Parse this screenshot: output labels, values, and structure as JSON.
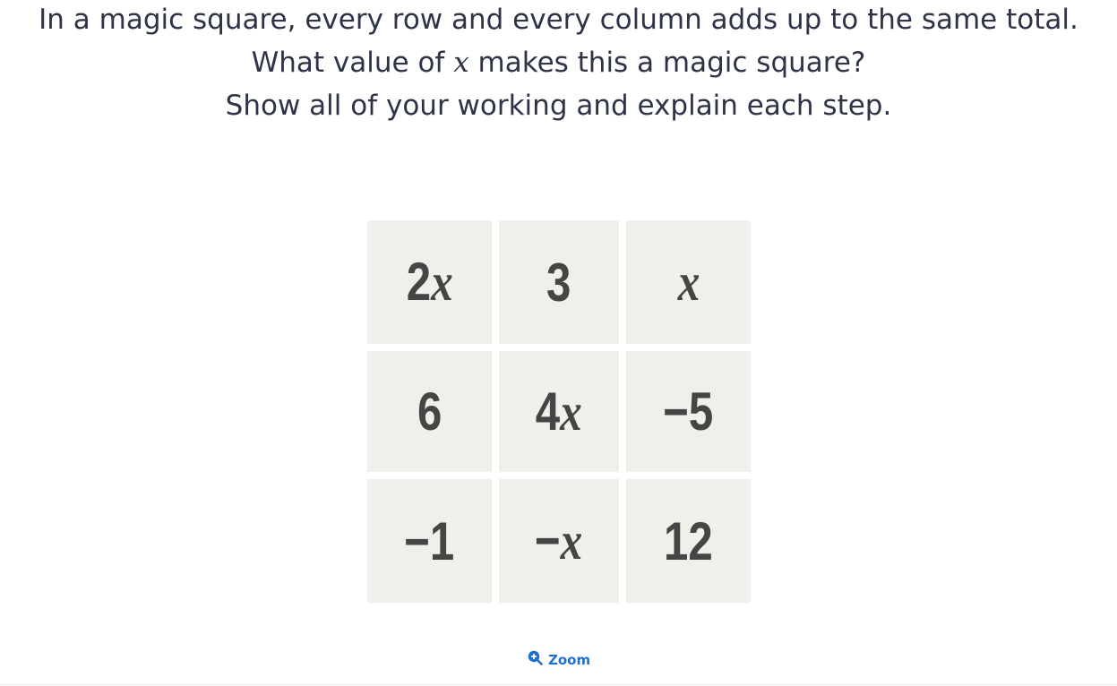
{
  "question": {
    "line1": "In a magic square, every row and every column adds up to the same total.",
    "line2_before": "What value of ",
    "line2_var": "x",
    "line2_after": " makes this a magic square?",
    "line3": "Show all of your working and explain each step."
  },
  "magic_square": {
    "rows": [
      [
        "2x",
        "3",
        "x"
      ],
      [
        "6",
        "4x",
        "−5"
      ],
      [
        "−1",
        "−x",
        "12"
      ]
    ]
  },
  "zoom_button": {
    "label": "Zoom",
    "icon": "zoom-in-icon"
  },
  "colors": {
    "cell_bg": "#f1efe9",
    "text": "#2e3447",
    "link": "#1f6fd1"
  }
}
